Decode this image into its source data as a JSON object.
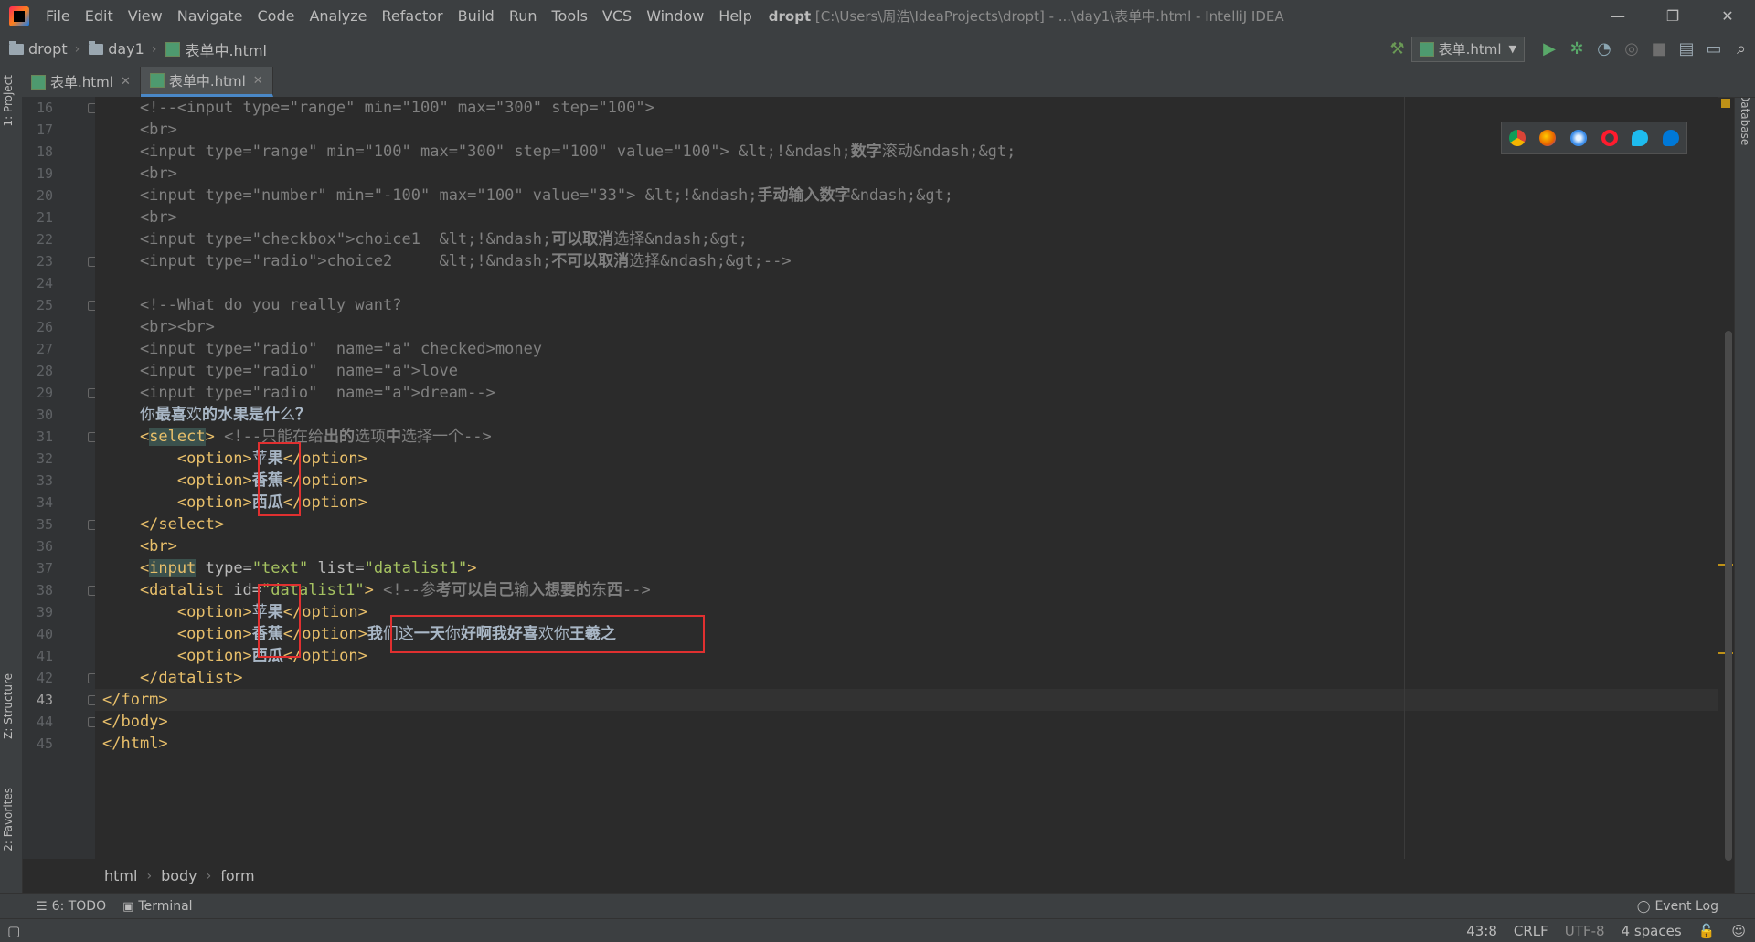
{
  "menubar": {
    "items": [
      "File",
      "Edit",
      "View",
      "Navigate",
      "Code",
      "Analyze",
      "Refactor",
      "Build",
      "Run",
      "Tools",
      "VCS",
      "Window",
      "Help"
    ],
    "project_name": "dropt",
    "title_rest": "[C:\\Users\\周浩\\IdeaProjects\\dropt] - ...\\day1\\表单中.html - IntelliJ IDEA",
    "window_controls": {
      "minimize": "—",
      "restore": "❐",
      "close": "✕"
    }
  },
  "navbar": {
    "crumbs": [
      "dropt",
      "day1",
      "表单中.html"
    ],
    "run_config": "表单.html"
  },
  "tabs": [
    {
      "label": "表单.html",
      "active": false
    },
    {
      "label": "表单中.html",
      "active": true
    }
  ],
  "side_tabs": {
    "project": "1: Project",
    "structure": "Z: Structure",
    "favorites": "2: Favorites",
    "database": "Database"
  },
  "editor": {
    "current_line": 43,
    "lines": [
      {
        "n": 16,
        "html": "<span class='cmt'>    &lt;!--&lt;input type=\"range\" min=\"100\" max=\"300\" step=\"100\"&gt;</span>",
        "fold": true
      },
      {
        "n": 17,
        "html": "<span class='cmt'>    &lt;br&gt;</span>"
      },
      {
        "n": 18,
        "html": "<span class='cmt'>    &lt;input type=\"range\" min=\"100\" max=\"300\" step=\"100\" value=\"100\"&gt; &amp;lt;!&amp;ndash;<b>数字</b>滚动&amp;ndash;&amp;gt;</span>"
      },
      {
        "n": 19,
        "html": "<span class='cmt'>    &lt;br&gt;</span>"
      },
      {
        "n": 20,
        "html": "<span class='cmt'>    &lt;input type=\"number\" min=\"-100\" max=\"100\" value=\"33\"&gt; &amp;lt;!&amp;ndash;<b>手动输入数字</b>&amp;ndash;&amp;gt;</span>"
      },
      {
        "n": 21,
        "html": "<span class='cmt'>    &lt;br&gt;</span>"
      },
      {
        "n": 22,
        "html": "<span class='cmt'>    &lt;input type=\"checkbox\"&gt;choice1  &amp;lt;!&amp;ndash;<b>可以取消</b>选择&amp;ndash;&amp;gt;</span>"
      },
      {
        "n": 23,
        "html": "<span class='cmt'>    &lt;input type=\"radio\"&gt;choice2     &amp;lt;!&amp;ndash;<b>不可以取消</b>选择&amp;ndash;&amp;gt;--&gt;</span>",
        "fold": true
      },
      {
        "n": 24,
        "html": ""
      },
      {
        "n": 25,
        "html": "<span class='cmt'>    &lt;!--What do you really want?</span>",
        "fold": true
      },
      {
        "n": 26,
        "html": "<span class='cmt'>    &lt;br&gt;&lt;br&gt;</span>"
      },
      {
        "n": 27,
        "html": "<span class='cmt'>    &lt;input type=\"radio\"  name=\"a\" checked&gt;money</span>"
      },
      {
        "n": 28,
        "html": "<span class='cmt'>    &lt;input type=\"radio\"  name=\"a\"&gt;love</span>"
      },
      {
        "n": 29,
        "html": "<span class='cmt'>    &lt;input type=\"radio\"  name=\"a\"&gt;dream--&gt;</span>",
        "fold": true
      },
      {
        "n": 30,
        "html": "<span class='txt'>    你<b>最喜</b>欢<b>的水果是什</b>么<b>？</b></span>"
      },
      {
        "n": 31,
        "html": "<span class='tag'>    &lt;<span style='background:#3b514d'>select</span>&gt; </span><span class='cmt'>&lt;!--只能在给<b>出的</b>选项<b>中</b>选择一个--&gt;</span>",
        "fold": true
      },
      {
        "n": 32,
        "html": "<span class='tag'>        &lt;option&gt;</span><span class='txt'>苹<b>果</b></span><span class='tag'>&lt;/option&gt;</span>"
      },
      {
        "n": 33,
        "html": "<span class='tag'>        &lt;option&gt;</span><span class='txt'><b>香蕉</b></span><span class='tag'>&lt;/option&gt;</span>"
      },
      {
        "n": 34,
        "html": "<span class='tag'>        &lt;option&gt;</span><span class='txt'><b>西瓜</b></span><span class='tag'>&lt;/option&gt;</span>"
      },
      {
        "n": 35,
        "html": "<span class='tag'>    &lt;/select&gt;</span>",
        "fold": true
      },
      {
        "n": 36,
        "html": "<span class='tag'>    &lt;br&gt;</span>"
      },
      {
        "n": 37,
        "html": "<span class='tag'>    &lt;<span style='background:#3b514d'>input</span> </span><span class='attr'>type=</span><span class='val'>\"text\"</span><span class='attr'> list=</span><span class='val'>\"datalist1\"</span><span class='tag'>&gt;</span>"
      },
      {
        "n": 38,
        "html": "<span class='tag'>    &lt;datalist </span><span class='attr'>id=</span><span class='val'>\"datalist1\"</span><span class='tag'>&gt; </span><span class='cmt'>&lt;!--参<b>考可以自己</b>输<b>入想要的</b>东<b>西</b>--&gt;</span>",
        "fold": true
      },
      {
        "n": 39,
        "html": "<span class='tag'>        &lt;option&gt;</span><span class='txt'>苹<b>果</b></span><span class='tag'>&lt;/option&gt;</span>"
      },
      {
        "n": 40,
        "html": "<span class='tag'>        &lt;option&gt;</span><span class='txt'><b>香蕉</b></span><span class='tag'>&lt;/option&gt;</span><span class='txt'><b>我</b>们这<b>一天</b>你<b>好啊我好喜</b>欢你<b>王羲之</b></span>"
      },
      {
        "n": 41,
        "html": "<span class='tag'>        &lt;option&gt;</span><span class='txt'><b>西瓜</b></span><span class='tag'>&lt;/option&gt;</span>"
      },
      {
        "n": 42,
        "html": "<span class='tag'>    &lt;/datalist&gt;</span>",
        "fold": true
      },
      {
        "n": 43,
        "html": "<span class='tag'>&lt;/form&gt;</span>",
        "fold": true
      },
      {
        "n": 44,
        "html": "<span class='tag'>&lt;/body&gt;</span>",
        "fold": true
      },
      {
        "n": 45,
        "html": "<span class='tag'>&lt;/html&gt;</span>"
      }
    ]
  },
  "breadcrumb": [
    "html",
    "body",
    "form"
  ],
  "toolwindows": {
    "todo": "6: TODO",
    "terminal": "Terminal",
    "event_log": "Event Log"
  },
  "status": {
    "position": "43:8",
    "line_sep": "CRLF",
    "encoding": "UTF-8",
    "indent": "4 spaces"
  },
  "colors": {
    "accent": "#4a88c7",
    "highlight_box": "#e03030",
    "warning_mark": "#be9117"
  }
}
